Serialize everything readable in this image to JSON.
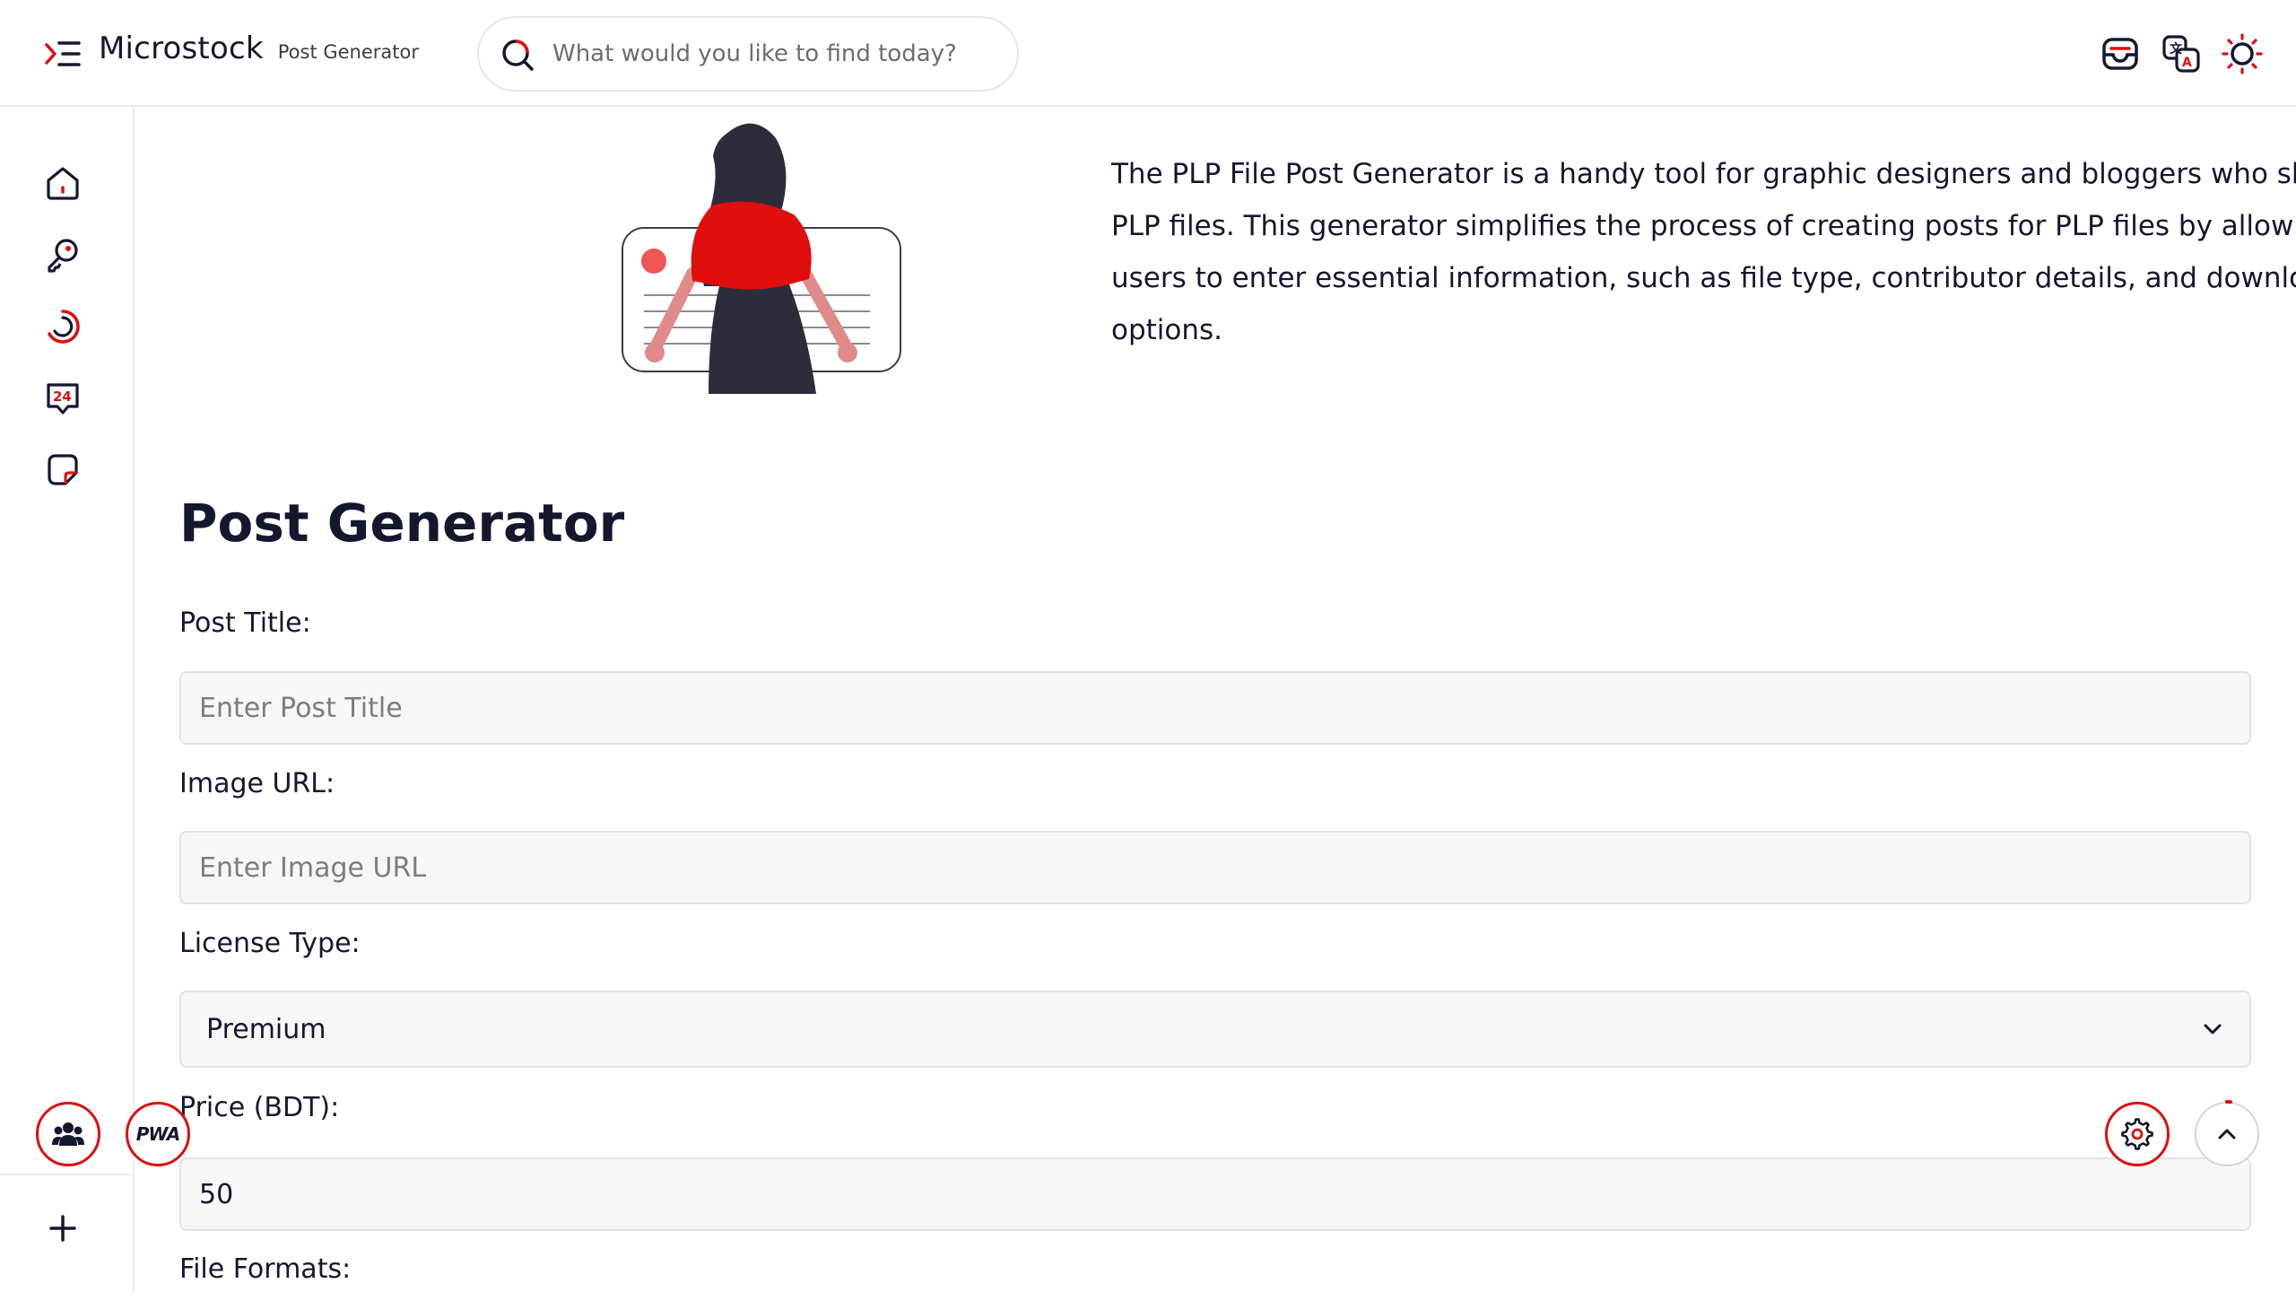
{
  "header": {
    "brand_name": "Microstock",
    "brand_sub": "Post Generator",
    "search_placeholder": "What would you like to find today?"
  },
  "intro": {
    "text": "The PLP File Post Generator is a handy tool for graphic designers and bloggers who share PLP files. This generator simplifies the process of creating posts for PLP files by allowing users to enter essential information, such as file type, contributor details, and download options."
  },
  "form": {
    "title": "Post Generator",
    "post_title_label": "Post Title:",
    "post_title_placeholder": "Enter Post Title",
    "image_url_label": "Image URL:",
    "image_url_placeholder": "Enter Image URL",
    "license_label": "License Type:",
    "license_value": "Premium",
    "price_label": "Price (BDT):",
    "price_value": "50",
    "formats_label": "File Formats:"
  },
  "floating": {
    "pwa_label": "PWA"
  },
  "icons": {
    "menu": "menu-toggle-icon",
    "search": "search-icon",
    "inbox": "inbox-icon",
    "translate": "translate-icon",
    "theme": "sun-icon",
    "home": "home-icon",
    "key": "key-icon",
    "loader": "spinner-icon",
    "support24": "support-24-icon",
    "note": "note-icon",
    "plus": "plus-icon",
    "community": "community-icon",
    "settings": "gear-icon",
    "scroll_top": "chevron-up-icon"
  },
  "colors": {
    "accent": "#e10e0e",
    "text": "#14182e",
    "field_bg": "#f7f7f7"
  }
}
